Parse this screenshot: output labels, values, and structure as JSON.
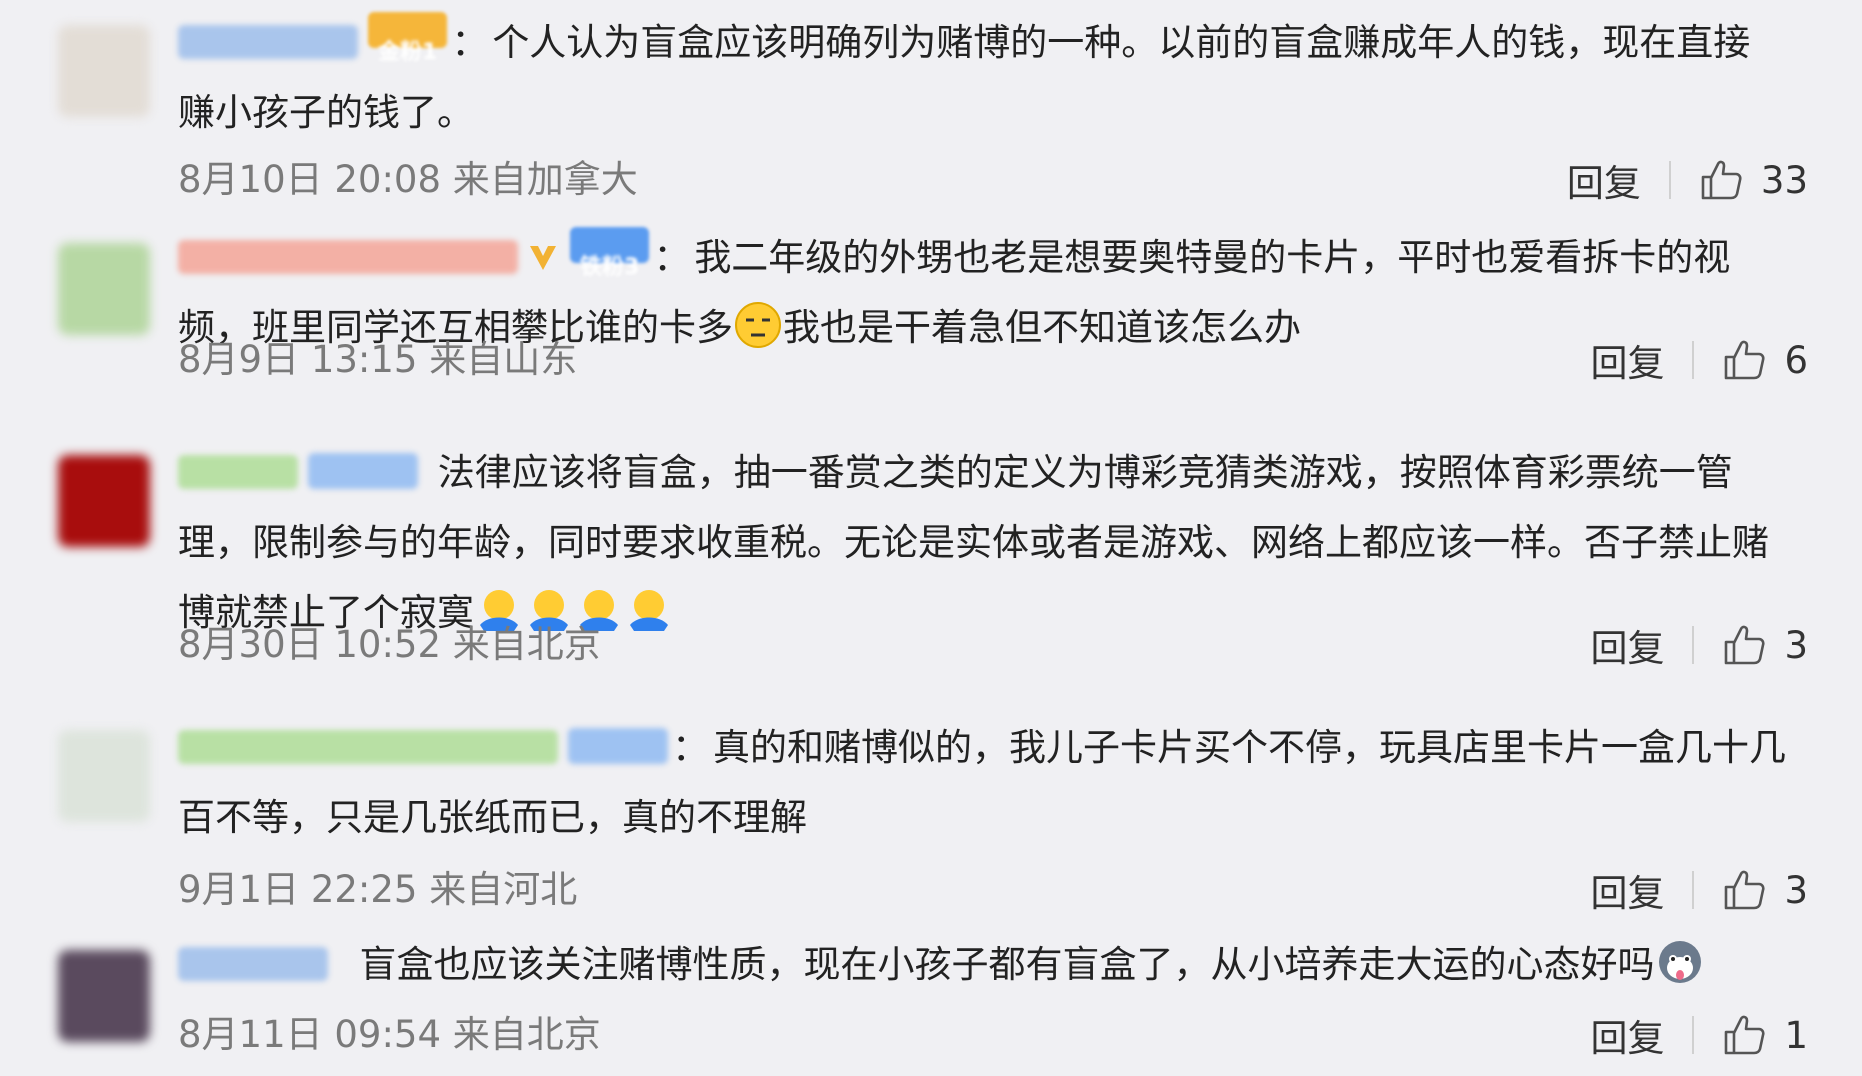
{
  "comments": [
    {
      "badge": "金粉1",
      "badge_color": "#f5a623",
      "text_line1": "个人认为盲盒应该明确列为赌博的一种。以前的盲盒赚成年人的钱，现在直接",
      "text_line2": "赚小孩子的钱了。",
      "time": "8月10日 20:08 来自加拿大",
      "reply": "回复",
      "likes": "33"
    },
    {
      "badge": "铁粉3",
      "badge_color": "#5b9cf0",
      "text_line1": "我二年级的外甥也老是想要奥特曼的卡片，平时也爱看拆卡的视",
      "text_line2a": "频，班里同学还互相攀比谁的卡多",
      "text_line2b": "我也是干着急但不知道该怎么办",
      "time": "8月9日 13:15 来自山东",
      "reply": "回复",
      "likes": "6"
    },
    {
      "text_line1": "法律应该将盲盒，抽一番赏之类的定义为博彩竞猜类游戏，按照体育彩票统一管",
      "text_line2": "理，限制参与的年龄，同时要求收重税。无论是实体或者是游戏、网络上都应该一样。否子禁止赌",
      "text_line3": "博就禁止了个寂寞",
      "time": "8月30日 10:52 来自北京",
      "reply": "回复",
      "likes": "3"
    },
    {
      "text_line1": "真的和赌博似的，我儿子卡片买个不停，玩具店里卡片一盒几十几",
      "text_line2": "百不等，只是几张纸而已，真的不理解",
      "time": "9月1日 22:25 来自河北",
      "reply": "回复",
      "likes": "3"
    },
    {
      "text_line1": "盲盒也应该关注赌博性质，现在小孩子都有盲盒了，从小培养走大运的心态好吗",
      "time": "8月11日 09:54 来自北京",
      "reply": "回复",
      "likes": "1"
    }
  ]
}
